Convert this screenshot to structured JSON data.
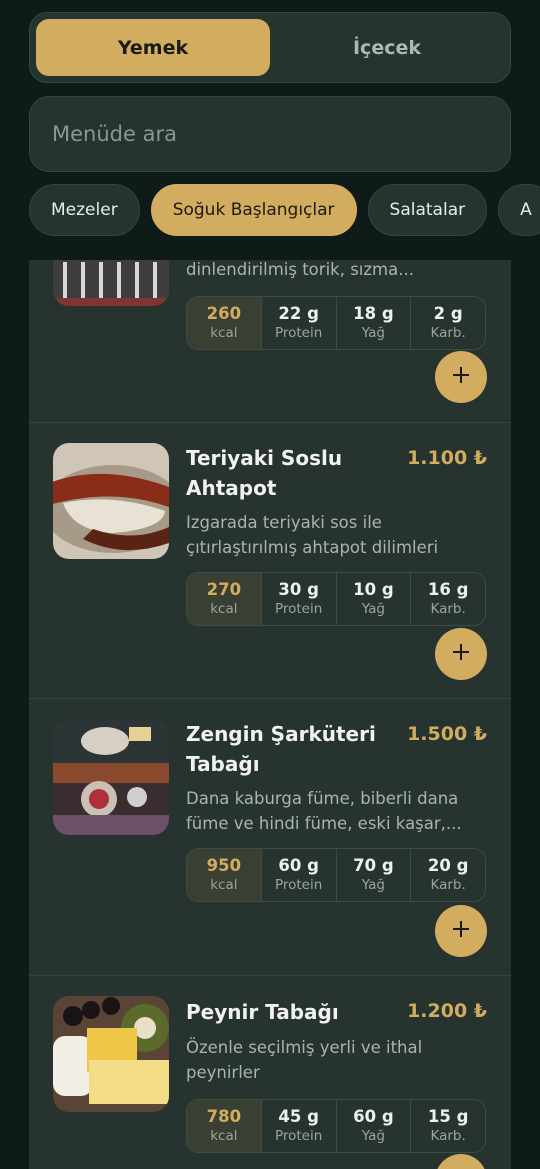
{
  "tabs": [
    {
      "label": "Yemek",
      "active": true
    },
    {
      "label": "İçecek",
      "active": false
    }
  ],
  "search": {
    "placeholder": "Menüde ara",
    "value": ""
  },
  "categories": [
    {
      "label": "Mezeler",
      "active": false
    },
    {
      "label": "Soğuk Başlangıçlar",
      "active": true
    },
    {
      "label": "Salatalar",
      "active": false
    },
    {
      "label": "A",
      "active": false
    }
  ],
  "colors": {
    "accent": "#d2ad60",
    "background": "#0f1b19",
    "card": "#26332f"
  },
  "items": [
    {
      "name": "",
      "price": "",
      "description": "dinlendirilmiş torik, sızma...",
      "macros": [
        {
          "value": "260",
          "label": "kcal"
        },
        {
          "value": "22 g",
          "label": "Protein"
        },
        {
          "value": "18 g",
          "label": "Yağ"
        },
        {
          "value": "2 g",
          "label": "Karb."
        }
      ]
    },
    {
      "name": "Teriyaki Soslu Ahtapot",
      "price": "1.100 ₺",
      "description": "Izgarada teriyaki sos ile çıtırlaştırılmış ahtapot dilimleri",
      "macros": [
        {
          "value": "270",
          "label": "kcal"
        },
        {
          "value": "30 g",
          "label": "Protein"
        },
        {
          "value": "10 g",
          "label": "Yağ"
        },
        {
          "value": "16 g",
          "label": "Karb."
        }
      ]
    },
    {
      "name": "Zengin Şarküteri Tabağı",
      "price": "1.500 ₺",
      "description": "Dana kaburga füme, biberli dana füme ve hindi füme, eski kaşar,...",
      "macros": [
        {
          "value": "950",
          "label": "kcal"
        },
        {
          "value": "60 g",
          "label": "Protein"
        },
        {
          "value": "70 g",
          "label": "Yağ"
        },
        {
          "value": "20 g",
          "label": "Karb."
        }
      ]
    },
    {
      "name": "Peynir Tabağı",
      "price": "1.200 ₺",
      "description": "Özenle seçilmiş yerli ve ithal peynirler",
      "macros": [
        {
          "value": "780",
          "label": "kcal"
        },
        {
          "value": "45 g",
          "label": "Protein"
        },
        {
          "value": "60 g",
          "label": "Yağ"
        },
        {
          "value": "15 g",
          "label": "Karb."
        }
      ]
    }
  ]
}
